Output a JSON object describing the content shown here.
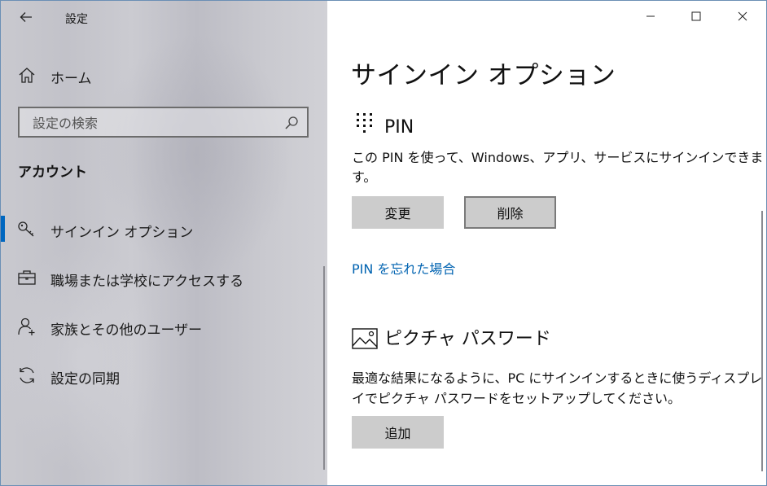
{
  "app": {
    "title": "設定"
  },
  "sidebar": {
    "home_label": "ホーム",
    "search_placeholder": "設定の検索",
    "section_title": "アカウント",
    "items": [
      {
        "label": "サインイン オプション",
        "icon": "key-icon",
        "selected": true
      },
      {
        "label": "職場または学校にアクセスする",
        "icon": "briefcase-icon",
        "selected": false
      },
      {
        "label": "家族とその他のユーザー",
        "icon": "add-person-icon",
        "selected": false
      },
      {
        "label": "設定の同期",
        "icon": "sync-icon",
        "selected": false
      }
    ]
  },
  "main": {
    "title": "サインイン オプション",
    "pin": {
      "heading": "PIN",
      "description_line1": "この PIN を使って、Windows、アプリ、サービスにサインインできま",
      "description_line2": "す。",
      "change_label": "変更",
      "remove_label": "削除",
      "forgot_link": "PIN を忘れた場合"
    },
    "picture_password": {
      "heading": "ピクチャ パスワード",
      "description_line1": "最適な結果になるように、PC にサインインするときに使うディスプレ",
      "description_line2": "イでピクチャ パスワードをセットアップしてください。",
      "add_label": "追加"
    }
  },
  "colors": {
    "accent": "#0067c0",
    "link": "#0063b1",
    "button": "#cccccc"
  }
}
